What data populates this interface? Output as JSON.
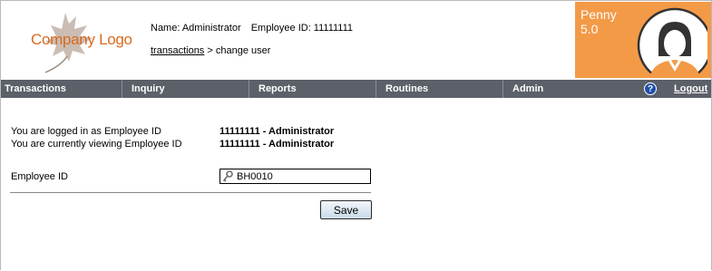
{
  "header": {
    "logo_text": "Company Logo",
    "name_label": "Name: Administrator",
    "employee_label": "Employee ID: 11111111",
    "breadcrumb_link": "transactions",
    "breadcrumb_rest": " > change user"
  },
  "brand": {
    "name": "Penny",
    "version": "5.0",
    "color": "#f39a47"
  },
  "nav": {
    "items": [
      "Transactions",
      "Inquiry",
      "Reports",
      "Routines",
      "Admin"
    ],
    "help_icon": "?",
    "logout": "Logout",
    "color": "#5c6068"
  },
  "main": {
    "logged_in_label": "You are logged in as Employee ID",
    "logged_in_value": "11111111 - Administrator",
    "viewing_label": "You are currently viewing Employee ID",
    "viewing_value": "11111111 - Administrator",
    "employee_id_label": "Employee ID",
    "employee_id_value": "BH0010",
    "save_label": "Save"
  },
  "icons": {
    "lookup": "key-icon",
    "help": "help-icon",
    "avatar": "user-avatar"
  }
}
